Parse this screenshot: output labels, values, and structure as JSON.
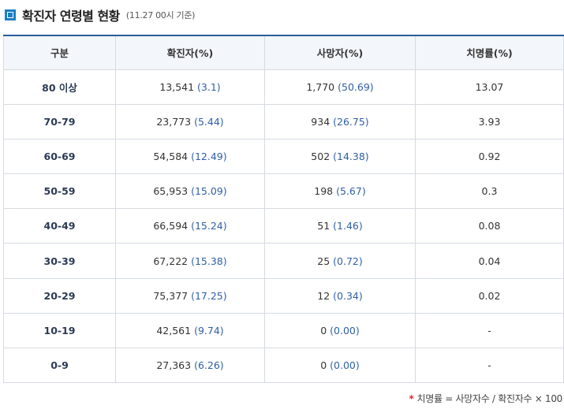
{
  "title": "확진자 연령별 현황",
  "title_note": "(11.27 00시 기준)",
  "accent_color": "#1a7fc4",
  "headers": [
    "구분",
    "확진자(%)",
    "사망자(%)",
    "치명률(%)"
  ],
  "rows": [
    {
      "group": "80 이상",
      "confirmed": "13,541",
      "confirmed_pct": "(3.1)",
      "deaths": "1,770",
      "deaths_pct": "(50.69)",
      "fatality": "13.07"
    },
    {
      "group": "70-79",
      "confirmed": "23,773",
      "confirmed_pct": "(5.44)",
      "deaths": "934",
      "deaths_pct": "(26.75)",
      "fatality": "3.93"
    },
    {
      "group": "60-69",
      "confirmed": "54,584",
      "confirmed_pct": "(12.49)",
      "deaths": "502",
      "deaths_pct": "(14.38)",
      "fatality": "0.92"
    },
    {
      "group": "50-59",
      "confirmed": "65,953",
      "confirmed_pct": "(15.09)",
      "deaths": "198",
      "deaths_pct": "(5.67)",
      "fatality": "0.3"
    },
    {
      "group": "40-49",
      "confirmed": "66,594",
      "confirmed_pct": "(15.24)",
      "deaths": "51",
      "deaths_pct": "(1.46)",
      "fatality": "0.08"
    },
    {
      "group": "30-39",
      "confirmed": "67,222",
      "confirmed_pct": "(15.38)",
      "deaths": "25",
      "deaths_pct": "(0.72)",
      "fatality": "0.04"
    },
    {
      "group": "20-29",
      "confirmed": "75,377",
      "confirmed_pct": "(17.25)",
      "deaths": "12",
      "deaths_pct": "(0.34)",
      "fatality": "0.02"
    },
    {
      "group": "10-19",
      "confirmed": "42,561",
      "confirmed_pct": "(9.74)",
      "deaths": "0",
      "deaths_pct": "(0.00)",
      "fatality": "-"
    },
    {
      "group": "0-9",
      "confirmed": "27,363",
      "confirmed_pct": "(6.26)",
      "deaths": "0",
      "deaths_pct": "(0.00)",
      "fatality": "-"
    }
  ],
  "footnote_star": "*",
  "footnote": "치명률 = 사망자수 / 확진자수 × 100"
}
